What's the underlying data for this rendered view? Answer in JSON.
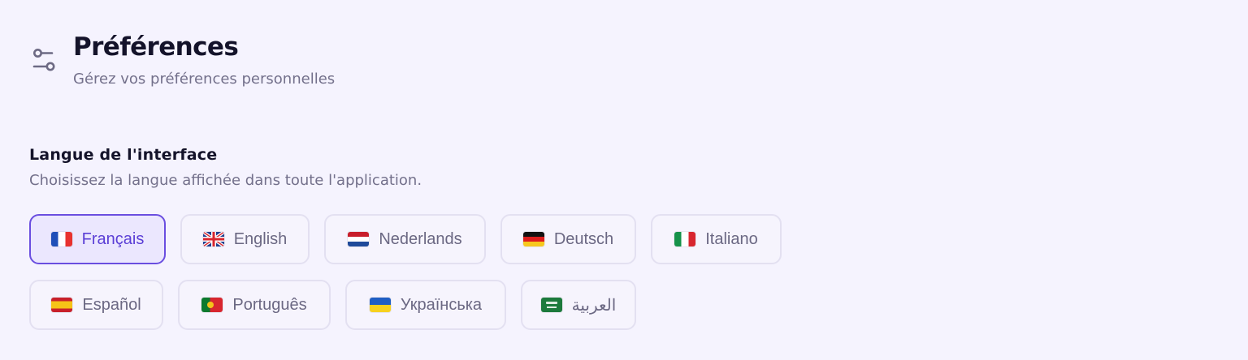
{
  "header": {
    "icon": "sliders-icon",
    "title": "Préférences",
    "subtitle": "Gérez vos préférences personnelles"
  },
  "language_section": {
    "title": "Langue de l'interface",
    "description": "Choisissez la langue affichée dans toute l'application.",
    "selected": "Français",
    "languages": [
      {
        "label": "Français",
        "flag": "flag-france-icon"
      },
      {
        "label": "English",
        "flag": "flag-uk-icon"
      },
      {
        "label": "Nederlands",
        "flag": "flag-netherlands-icon"
      },
      {
        "label": "Deutsch",
        "flag": "flag-germany-icon"
      },
      {
        "label": "Italiano",
        "flag": "flag-italy-icon"
      },
      {
        "label": "Español",
        "flag": "flag-spain-icon"
      },
      {
        "label": "Português",
        "flag": "flag-portugal-icon"
      },
      {
        "label": "Українська",
        "flag": "flag-ukraine-icon"
      },
      {
        "label": "العربية",
        "flag": "flag-saudi-arabia-icon"
      }
    ]
  },
  "colors": {
    "background": "#f5f3fe",
    "accent": "#5b3fd6",
    "title_text": "#14132a",
    "muted_text": "#73708b"
  }
}
